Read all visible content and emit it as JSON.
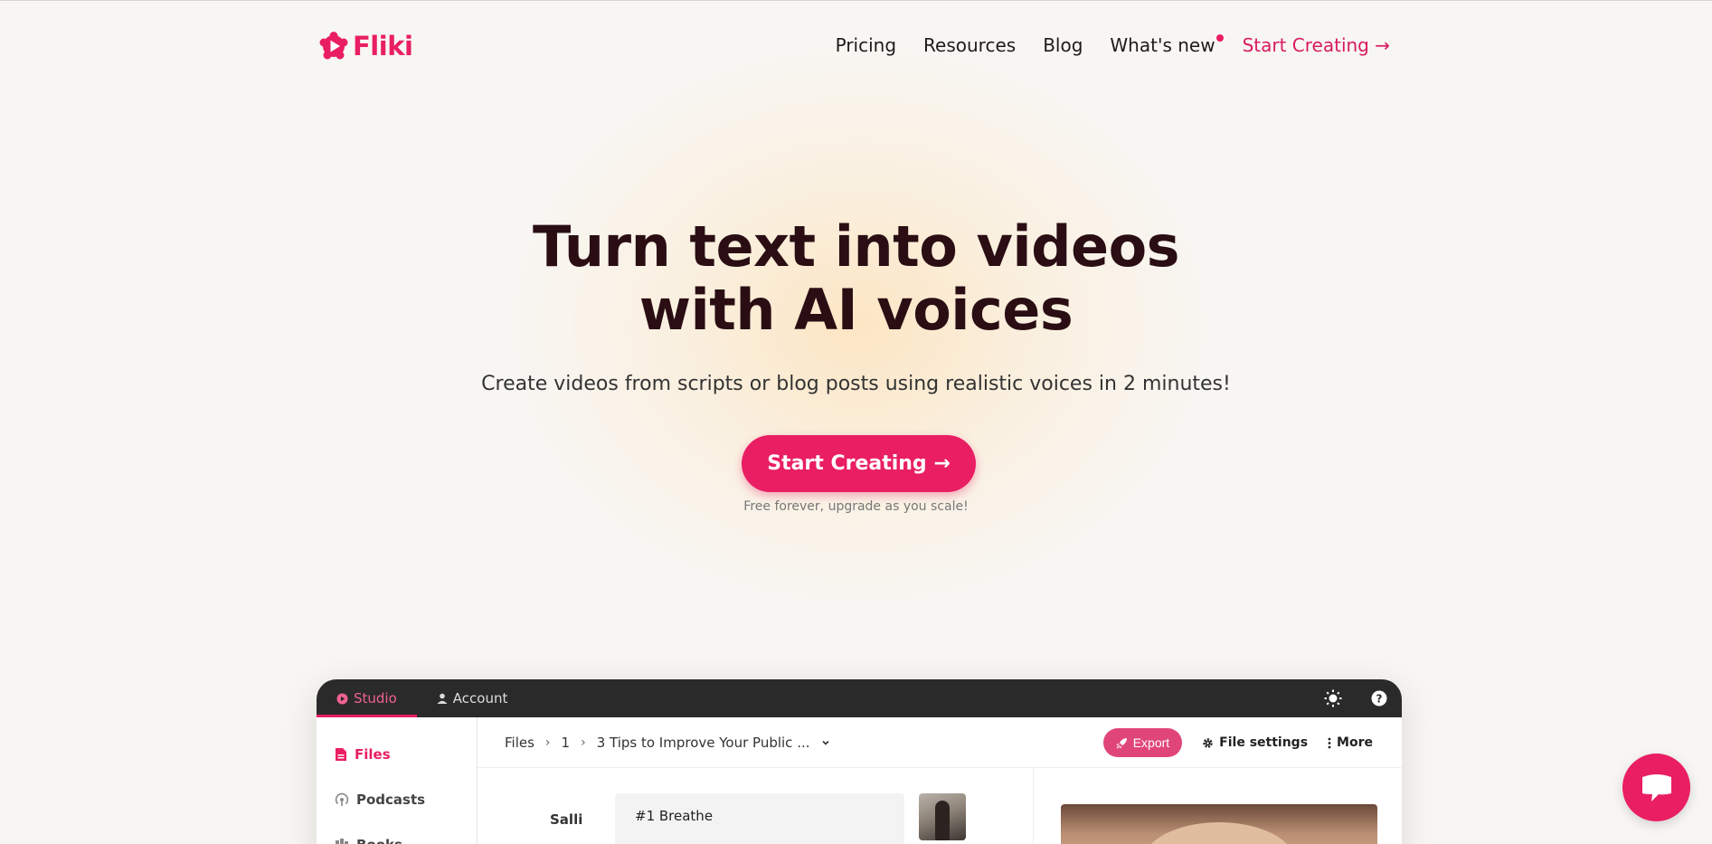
{
  "brand": {
    "name": "Fliki",
    "accent": "#e91e63"
  },
  "nav": {
    "items": [
      "Pricing",
      "Resources",
      "Blog",
      "What's new"
    ],
    "cta": "Start Creating →"
  },
  "hero": {
    "title_line1": "Turn text into videos",
    "title_line2": "with AI voices",
    "subtitle": "Create videos from scripts or blog posts using realistic voices in 2 minutes!",
    "button": "Start Creating →",
    "note": "Free forever, upgrade as you scale!"
  },
  "app": {
    "tabs": [
      "Studio",
      "Account"
    ],
    "sidebar": [
      "Files",
      "Podcasts",
      "Books"
    ],
    "breadcrumbs": [
      "Files",
      "1",
      "3 Tips to Improve Your Public ..."
    ],
    "actions": {
      "export": "Export",
      "file_settings": "File settings",
      "more": "More"
    },
    "scene": {
      "voice": "Salli",
      "text": "#1 Breathe"
    },
    "icons": [
      "studio-icon",
      "account-icon",
      "brightness-icon",
      "help-icon",
      "file-icon",
      "podcast-icon",
      "book-icon",
      "rocket-icon",
      "gear-icon",
      "more-vert-icon",
      "chevron-down-icon"
    ]
  },
  "chat": {
    "icon": "chat-icon"
  }
}
